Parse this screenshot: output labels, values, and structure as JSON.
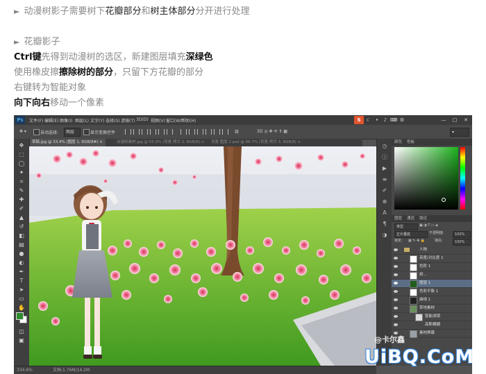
{
  "instructions": {
    "line1": {
      "t1": "动漫树影子需要树下",
      "t2": "花瓣部分",
      "t3": "和",
      "t4": "树主体部分",
      "t5": "分开进行处理"
    },
    "line2": {
      "text": "花瓣影子"
    },
    "line3": {
      "t1": "Ctrl键",
      "t2": "先得到动漫树的选区，新建图层填充",
      "t3": "深绿色"
    },
    "line4": {
      "t1": "使用橡皮擦",
      "t2": "擦除树的部分",
      "t3": "，只留下方花瓣的部分"
    },
    "line5": {
      "text": "右键转为智能对象"
    },
    "line6": {
      "t1": "向下向右",
      "t2": "移动一个像素"
    }
  },
  "photoshop": {
    "logo": "Ps",
    "menu": [
      "文件(F)",
      "编辑(E)",
      "图像(I)",
      "图层(L)",
      "文字(Y)",
      "选择(S)",
      "滤镜(T)",
      "3D(D)",
      "视图(V)",
      "窗口(W)",
      "帮助(H)"
    ],
    "options_bar": {
      "auto_select_label": "自动选择:",
      "auto_select_value": "图层",
      "transform_label": "显示变换控件"
    },
    "tabs": [
      {
        "label": "草稿.jpg @ 33.4% (图层 1, RGB/8#) ×"
      },
      {
        "label": "动漫树素材.jpg @ 55.9% (背景 拷贝 2, RGB/8) ×"
      },
      {
        "label": "背景 图层 2.psd @ 66.7% (背景 拷贝 3, RGB/8) ×"
      }
    ],
    "status": {
      "zoom": "334.6%",
      "doc": "文档:1.76M/14.2M"
    },
    "panels": {
      "tabs": [
        "颜色",
        "色板"
      ],
      "layers_tabs": [
        "图层",
        "通道",
        "路径"
      ],
      "kind_label": "类型",
      "blend_mode": "正片叠底",
      "opacity_label": "不透明度:",
      "opacity_value": "100%",
      "lock_label": "锁定:",
      "fill_label": "填充:",
      "fill_value": "100%",
      "layers": [
        {
          "name": "人物"
        },
        {
          "name": "亮度/对比度 1"
        },
        {
          "name": "色阶 1"
        },
        {
          "name": "树..."
        },
        {
          "name": "图层 1"
        },
        {
          "name": "色彩平衡 1"
        },
        {
          "name": "曲线 1"
        },
        {
          "name": "草地素材"
        },
        {
          "name": "智能滤镜"
        },
        {
          "name": "高斯模糊"
        },
        {
          "name": "素材屏幕"
        }
      ]
    }
  },
  "watermark": {
    "small": "@卡尔鑫",
    "large": "UiBQ.CoM"
  },
  "colors": {
    "accent_fill": "#2e8b2e",
    "ps_bg": "#535353",
    "selected_layer": "#5b6e86"
  }
}
